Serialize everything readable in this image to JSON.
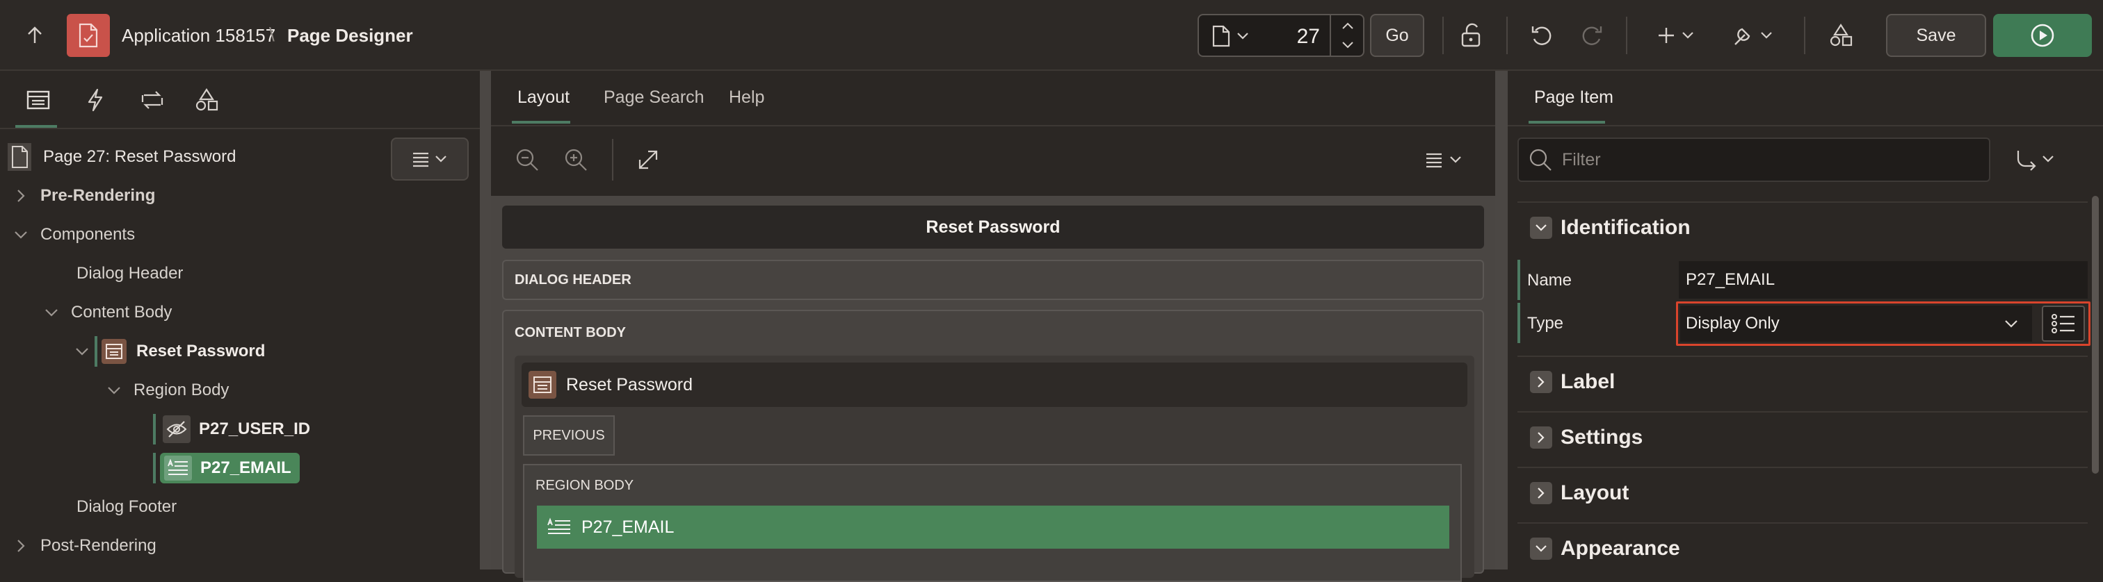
{
  "topbar": {
    "app_name": "Application 158157",
    "breadcrumb_separator": "\\",
    "page_name": "Page Designer",
    "page_number": "27",
    "go_label": "Go",
    "save_label": "Save"
  },
  "left": {
    "page_title": "Page 27: Reset Password",
    "tree": {
      "pre_rendering": "Pre-Rendering",
      "components": "Components",
      "dialog_header": "Dialog Header",
      "content_body": "Content Body",
      "reset_password": "Reset Password",
      "region_body": "Region Body",
      "p27_user_id": "P27_USER_ID",
      "p27_email": "P27_EMAIL",
      "dialog_footer": "Dialog Footer",
      "post_rendering": "Post-Rendering"
    }
  },
  "middle": {
    "tabs": [
      "Layout",
      "Page Search",
      "Help"
    ],
    "layout": {
      "dialog_title": "Reset Password",
      "dialog_header": "DIALOG HEADER",
      "content_body": "CONTENT BODY",
      "region_title": "Reset Password",
      "previous": "PREVIOUS",
      "region_body": "REGION BODY",
      "item": "P27_EMAIL"
    }
  },
  "right": {
    "tab": "Page Item",
    "filter_placeholder": "Filter",
    "sections": {
      "identification": "Identification",
      "label": "Label",
      "settings": "Settings",
      "layout": "Layout",
      "appearance": "Appearance"
    },
    "name_label": "Name",
    "name_value": "P27_EMAIL",
    "type_label": "Type",
    "type_value": "Display Only"
  },
  "colors": {
    "save_green": "#3f7b55",
    "item_green": "#4a8659",
    "app_icon_red": "#c9524a",
    "highlight_red": "#d9442c",
    "accent_border": "#4d7b63"
  }
}
